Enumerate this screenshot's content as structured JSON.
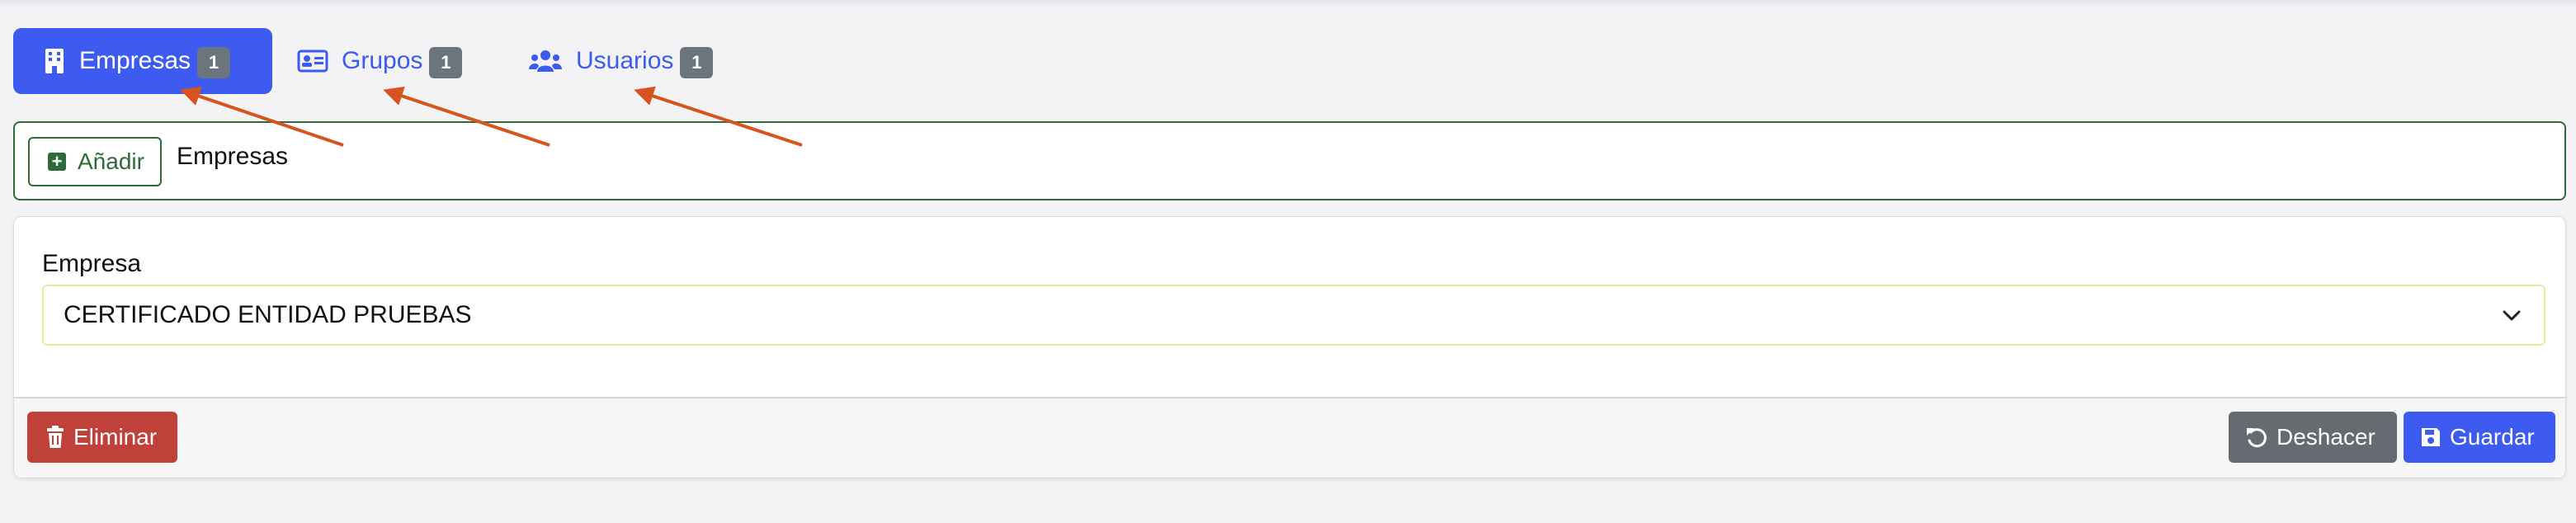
{
  "tabs": [
    {
      "label": "Empresas",
      "count": "1",
      "icon": "building-icon",
      "active": true
    },
    {
      "label": "Grupos",
      "count": "1",
      "icon": "id-card-icon",
      "active": false
    },
    {
      "label": "Usuarios",
      "count": "1",
      "icon": "users-icon",
      "active": false
    }
  ],
  "toolbar": {
    "add_label": "Añadir",
    "title": "Empresas"
  },
  "form": {
    "field_label": "Empresa",
    "selected_value": "CERTIFICADO ENTIDAD PRUEBAS"
  },
  "actions": {
    "delete_label": "Eliminar",
    "undo_label": "Deshacer",
    "save_label": "Guardar"
  },
  "colors": {
    "accent": "#3d5af1",
    "success": "#2f6b3a",
    "danger": "#c0403a",
    "secondary": "#666b72",
    "badge": "#6c757d",
    "annotation_arrow": "#d9531e"
  }
}
